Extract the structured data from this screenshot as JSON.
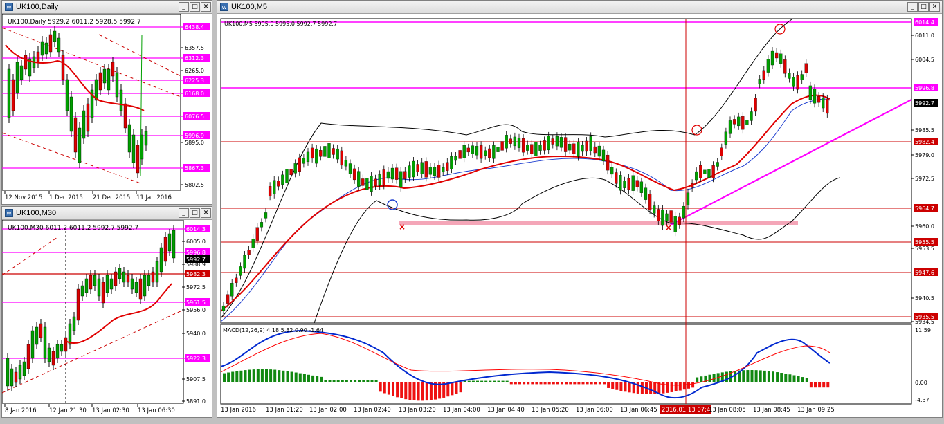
{
  "colors": {
    "accent_line": "#ff00ff",
    "level_line": "#cc0000",
    "bull": "#00a000",
    "bear": "#dd0000",
    "ma_red": "#e00000",
    "ma_blue": "#1f3fd0",
    "macd_line": "#0028d0",
    "macd_signal": "#ff0000"
  },
  "windows": {
    "daily": {
      "title": "UK100,Daily",
      "info": "UK100,Daily  5929.2 6011.2 5928.5 5992.7",
      "price_labels": [
        "6438.4",
        "6357.5",
        "6312.3",
        "6265.0",
        "6225.3",
        "6168.0",
        "6076.5",
        "5996.9",
        "5895.0",
        "5867.3",
        "5802.5"
      ],
      "x_labels": [
        "12 Nov 2015",
        "1 Dec 2015",
        "21 Dec 2015",
        "11 Jan 2016"
      ]
    },
    "m30": {
      "title": "UK100,M30",
      "info": "UK100,M30  6011.2 6011.2 5992.7 5992.7",
      "price_labels": [
        "6014.3",
        "6005.0",
        "5996.8",
        "5992.7",
        "5988.9",
        "5982.3",
        "5972.5",
        "5961.5",
        "5956.0",
        "5940.0",
        "5922.3",
        "5907.5",
        "5891.0"
      ],
      "x_labels": [
        "8 Jan 2016",
        "12 Jan 21:30",
        "13 Jan 02:30",
        "13 Jan 06:30"
      ]
    },
    "m5": {
      "title": "UK100,M5",
      "info": "UK100,M5  5995.0 5995.0 5992.7 5992.7",
      "price_labels": [
        "6014.4",
        "6011.0",
        "6004.5",
        "5996.8",
        "5992.7",
        "5985.5",
        "5982.4",
        "5979.0",
        "5972.5",
        "5964.7",
        "5960.0",
        "5955.5",
        "5953.5",
        "5947.6",
        "5940.5",
        "5935.5",
        "5934.5"
      ],
      "macd_info": "MACD(12,26,9) 4.18 5.82 0.90 -1.64",
      "macd_labels": [
        "11.59",
        "0.00",
        "-4.37"
      ],
      "x_labels": [
        "13 Jan 2016",
        "13 Jan 01:20",
        "13 Jan 02:00",
        "13 Jan 02:40",
        "13 Jan 03:20",
        "13 Jan 04:00",
        "13 Jan 04:40",
        "13 Jan 05:20",
        "13 Jan 06:00",
        "13 Jan 06:45",
        "2016.01.13 07:45",
        "13 Jan 08:05",
        "13 Jan 08:45",
        "13 Jan 09:25"
      ],
      "crosshair_label": "2016.01.13 07:45"
    }
  },
  "buttons": {
    "minimize": "_",
    "maximize": "□",
    "close": "✕"
  }
}
